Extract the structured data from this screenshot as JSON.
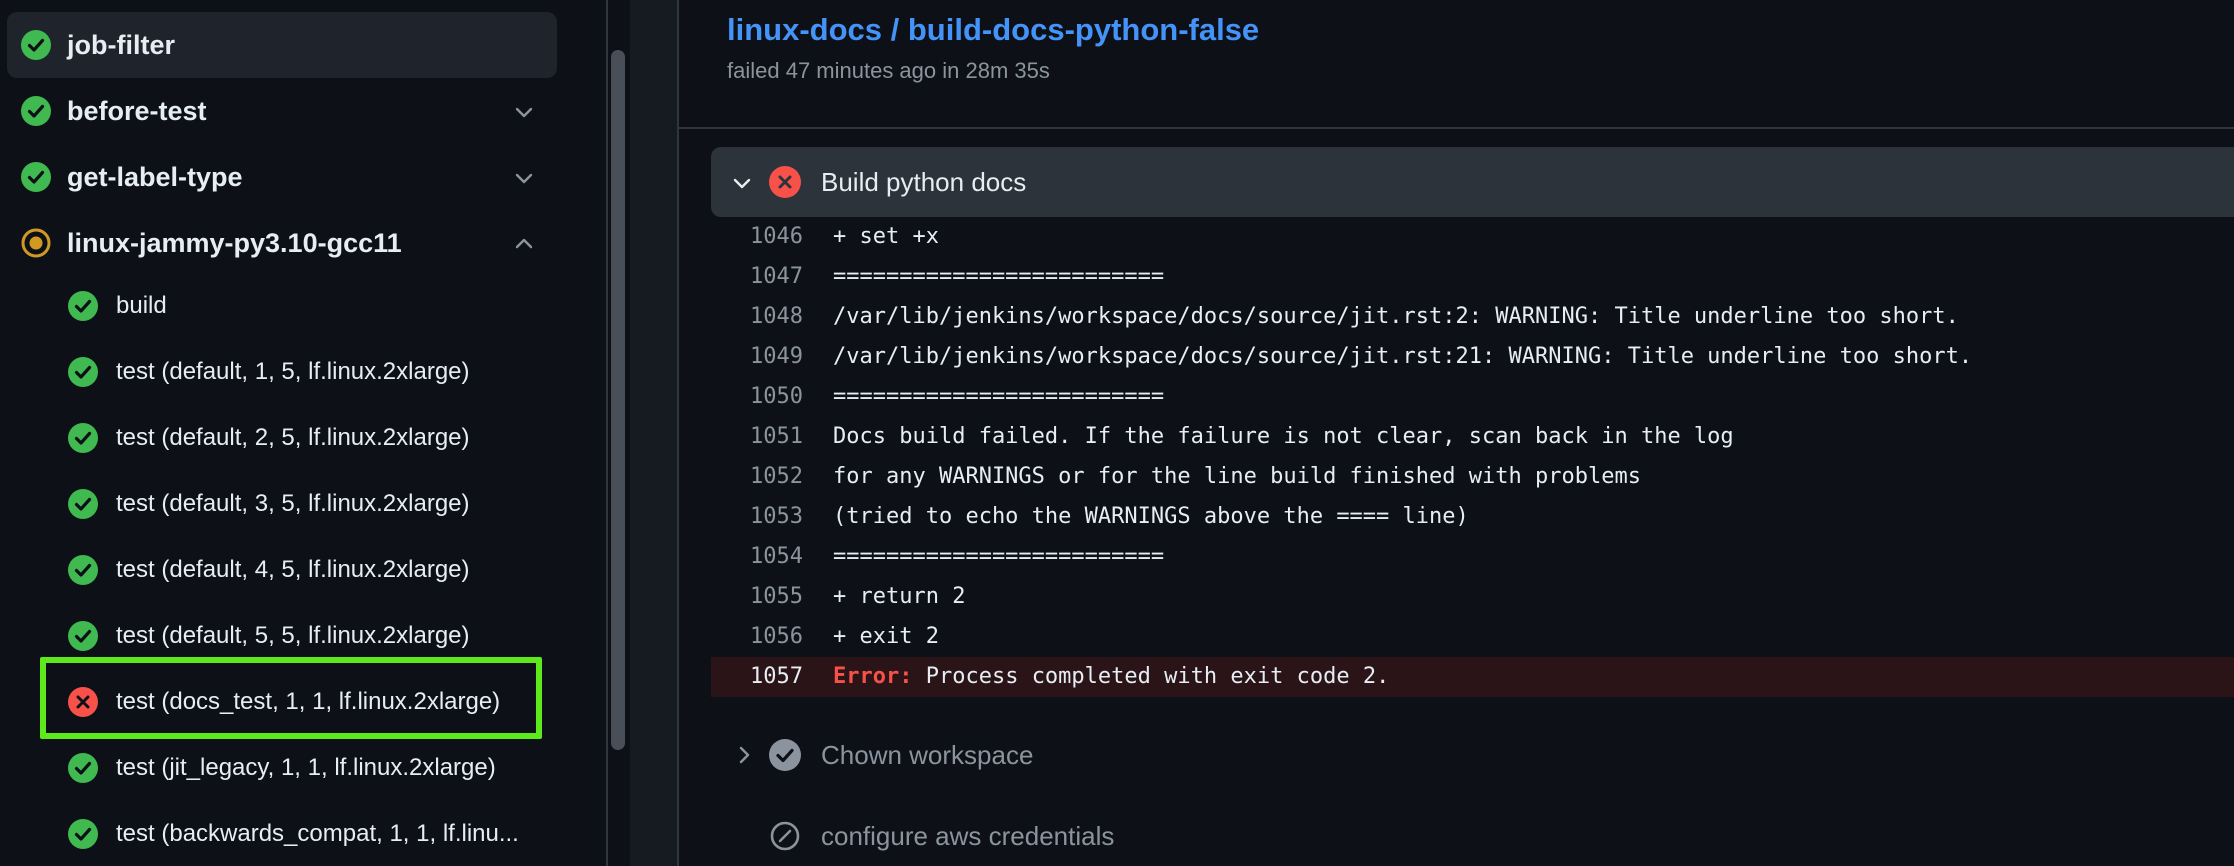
{
  "sidebar": {
    "jobs": [
      {
        "label": "job-filter",
        "status": "success",
        "icon": "check-circle-icon"
      },
      {
        "label": "before-test",
        "status": "success",
        "icon": "check-circle-icon",
        "expand": "chevron-down-icon"
      },
      {
        "label": "get-label-type",
        "status": "success",
        "icon": "check-circle-icon",
        "expand": "chevron-down-icon"
      },
      {
        "label": "linux-jammy-py3.10-gcc11",
        "status": "in-progress",
        "icon": "in-progress-icon",
        "expand": "chevron-up-icon"
      }
    ],
    "subjobs": [
      {
        "label": "build",
        "status": "success"
      },
      {
        "label": "test (default, 1, 5, lf.linux.2xlarge)",
        "status": "success"
      },
      {
        "label": "test (default, 2, 5, lf.linux.2xlarge)",
        "status": "success"
      },
      {
        "label": "test (default, 3, 5, lf.linux.2xlarge)",
        "status": "success"
      },
      {
        "label": "test (default, 4, 5, lf.linux.2xlarge)",
        "status": "success"
      },
      {
        "label": "test (default, 5, 5, lf.linux.2xlarge)",
        "status": "success"
      },
      {
        "label": "test (docs_test, 1, 1, lf.linux.2xlarge)",
        "status": "failure"
      },
      {
        "label": "test (jit_legacy, 1, 1, lf.linux.2xlarge)",
        "status": "success"
      },
      {
        "label": "test (backwards_compat, 1, 1, lf.linu...",
        "status": "success"
      }
    ]
  },
  "job": {
    "title": "linux-docs / build-docs-python-false",
    "status": "failed 47 minutes ago in 28m 35s"
  },
  "step": {
    "title": "Build python docs",
    "status": "failure"
  },
  "log": [
    {
      "num": "1046",
      "text": "+ set +x"
    },
    {
      "num": "1047",
      "text": "========================="
    },
    {
      "num": "1048",
      "text": "/var/lib/jenkins/workspace/docs/source/jit.rst:2: WARNING: Title underline too short."
    },
    {
      "num": "1049",
      "text": "/var/lib/jenkins/workspace/docs/source/jit.rst:21: WARNING: Title underline too short."
    },
    {
      "num": "1050",
      "text": "========================="
    },
    {
      "num": "1051",
      "text": "Docs build failed. If the failure is not clear, scan back in the log"
    },
    {
      "num": "1052",
      "text": "for any WARNINGS or for the line build finished with problems"
    },
    {
      "num": "1053",
      "text": "(tried to echo the WARNINGS above the ==== line)"
    },
    {
      "num": "1054",
      "text": "========================="
    },
    {
      "num": "1055",
      "text": "+ return 2"
    },
    {
      "num": "1056",
      "text": "+ exit 2"
    }
  ],
  "error_line": {
    "num": "1057",
    "prefix": "Error:",
    "text": " Process completed with exit code 2."
  },
  "next_steps": [
    {
      "label": "Chown workspace",
      "status": "success",
      "icon": "check-circle-icon"
    },
    {
      "label": "configure aws credentials",
      "status": "skipped",
      "icon": "skipped-icon"
    }
  ],
  "colors": {
    "success": "#3fb950",
    "failure": "#f85149",
    "in_progress": "#d29922",
    "link": "#4493f8",
    "highlight": "#5eea1a"
  }
}
